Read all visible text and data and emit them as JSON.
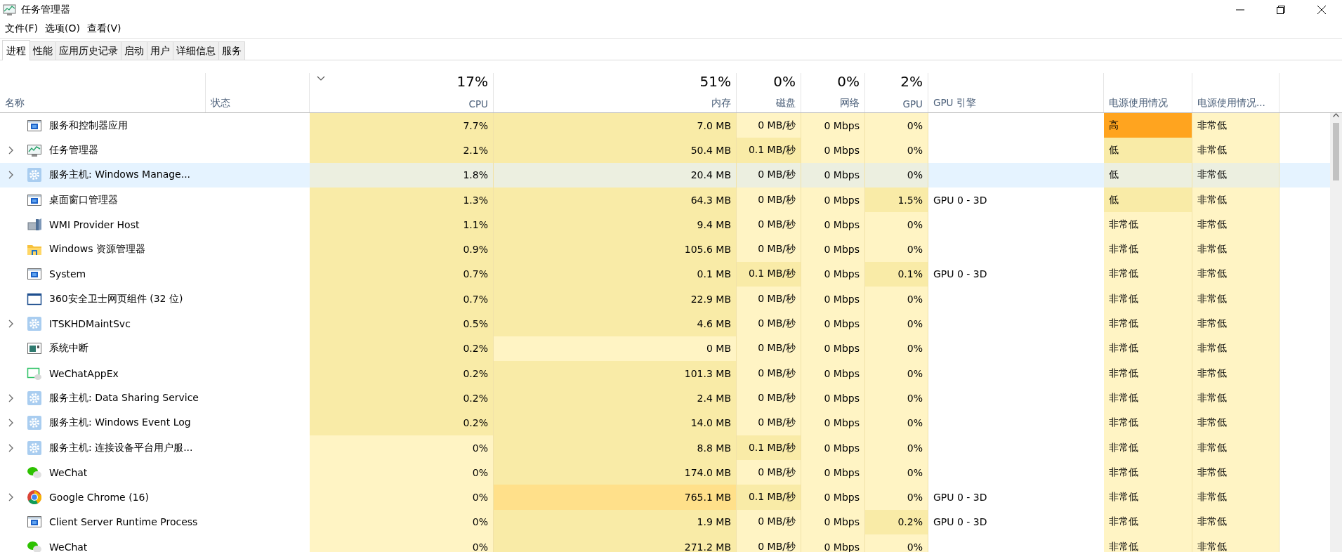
{
  "window": {
    "title": "任务管理器"
  },
  "menu": [
    "文件(F)",
    "选项(O)",
    "查看(V)"
  ],
  "tabs": [
    {
      "label": "进程",
      "selected": true
    },
    {
      "label": "性能",
      "selected": false
    },
    {
      "label": "应用历史记录",
      "selected": false
    },
    {
      "label": "启动",
      "selected": false
    },
    {
      "label": "用户",
      "selected": false
    },
    {
      "label": "详细信息",
      "selected": false
    },
    {
      "label": "服务",
      "selected": false
    }
  ],
  "columns": [
    {
      "label": "名称",
      "sorted": false
    },
    {
      "label": "状态",
      "sorted": false
    },
    {
      "percent": "17%",
      "label": "CPU",
      "sorted": true
    },
    {
      "percent": "51%",
      "label": "内存",
      "sorted": false
    },
    {
      "percent": "0%",
      "label": "磁盘",
      "sorted": false
    },
    {
      "percent": "0%",
      "label": "网络",
      "sorted": false
    },
    {
      "percent": "2%",
      "label": "GPU",
      "sorted": false
    },
    {
      "label": "GPU 引擎",
      "sorted": false
    },
    {
      "label": "电源使用情况",
      "sorted": false
    },
    {
      "label": "电源使用情况...",
      "sorted": false
    }
  ],
  "rows": [
    {
      "name": "服务和控制器应用",
      "kind": "app",
      "expandable": false,
      "selected": false,
      "cells": [
        {
          "text": "7.7%",
          "color": "#f9eba7"
        },
        {
          "text": "7.0 MB",
          "color": "#f9eba7"
        },
        {
          "text": "0 MB/秒",
          "color": "#fff4c4"
        },
        {
          "text": "0 Mbps",
          "color": "#fff4c4"
        },
        {
          "text": "0%",
          "color": "#fff4c4"
        },
        {
          "text": "高",
          "color": "#ffa41f"
        },
        {
          "text": "非常低",
          "color": "#fff4c4"
        }
      ]
    },
    {
      "name": "任务管理器",
      "kind": "taskmgr",
      "expandable": true,
      "selected": false,
      "cells": [
        {
          "text": "2.1%",
          "color": "#f9eba7"
        },
        {
          "text": "50.4 MB",
          "color": "#f9eba7"
        },
        {
          "text": "0.1 MB/秒",
          "color": "#f9eba7"
        },
        {
          "text": "0 Mbps",
          "color": "#fff4c4"
        },
        {
          "text": "0%",
          "color": "#fff4c4"
        },
        {
          "text": "低",
          "color": "#f9eba7"
        },
        {
          "text": "非常低",
          "color": "#fff4c4"
        }
      ]
    },
    {
      "name": "服务主机: Windows Manage...",
      "kind": "service",
      "expandable": true,
      "selected": true,
      "cells": [
        {
          "text": "1.8%",
          "color": "#ecefe0"
        },
        {
          "text": "20.4 MB",
          "color": "#ecefe0"
        },
        {
          "text": "0 MB/秒",
          "color": "#ecefe0"
        },
        {
          "text": "0 Mbps",
          "color": "#ecefe0"
        },
        {
          "text": "0%",
          "color": "#ecefe0"
        },
        {
          "text": "低",
          "color": "#ecefe0"
        },
        {
          "text": "非常低",
          "color": "#ecefe0"
        }
      ]
    },
    {
      "name": "桌面窗口管理器",
      "kind": "app",
      "expandable": false,
      "selected": false,
      "gpu_engine": "GPU 0 - 3D",
      "cells": [
        {
          "text": "1.3%",
          "color": "#f9eba7"
        },
        {
          "text": "64.3 MB",
          "color": "#f9eba7"
        },
        {
          "text": "0 MB/秒",
          "color": "#fff4c4"
        },
        {
          "text": "0 Mbps",
          "color": "#fff4c4"
        },
        {
          "text": "1.5%",
          "color": "#f9eba7"
        },
        {
          "text": "低",
          "color": "#f9eba7"
        },
        {
          "text": "非常低",
          "color": "#fff4c4"
        }
      ]
    },
    {
      "name": "WMI Provider Host",
      "kind": "wmi",
      "expandable": false,
      "selected": false,
      "cells": [
        {
          "text": "1.1%",
          "color": "#f9eba7"
        },
        {
          "text": "9.4 MB",
          "color": "#f9eba7"
        },
        {
          "text": "0 MB/秒",
          "color": "#fff4c4"
        },
        {
          "text": "0 Mbps",
          "color": "#fff4c4"
        },
        {
          "text": "0%",
          "color": "#fff4c4"
        },
        {
          "text": "非常低",
          "color": "#fff4c4"
        },
        {
          "text": "非常低",
          "color": "#fff4c4"
        }
      ]
    },
    {
      "name": "Windows 资源管理器",
      "kind": "explorer",
      "expandable": false,
      "selected": false,
      "cells": [
        {
          "text": "0.9%",
          "color": "#f9eba7"
        },
        {
          "text": "105.6 MB",
          "color": "#f9eba7"
        },
        {
          "text": "0 MB/秒",
          "color": "#fff4c4"
        },
        {
          "text": "0 Mbps",
          "color": "#fff4c4"
        },
        {
          "text": "0%",
          "color": "#fff4c4"
        },
        {
          "text": "非常低",
          "color": "#fff4c4"
        },
        {
          "text": "非常低",
          "color": "#fff4c4"
        }
      ]
    },
    {
      "name": "System",
      "kind": "app",
      "expandable": false,
      "selected": false,
      "gpu_engine": "GPU 0 - 3D",
      "cells": [
        {
          "text": "0.7%",
          "color": "#f9eba7"
        },
        {
          "text": "0.1 MB",
          "color": "#f9eba7"
        },
        {
          "text": "0.1 MB/秒",
          "color": "#f9eba7"
        },
        {
          "text": "0 Mbps",
          "color": "#fff4c4"
        },
        {
          "text": "0.1%",
          "color": "#f9eba7"
        },
        {
          "text": "非常低",
          "color": "#fff4c4"
        },
        {
          "text": "非常低",
          "color": "#fff4c4"
        }
      ]
    },
    {
      "name": "360安全卫士网页组件 (32 位)",
      "kind": "window",
      "expandable": false,
      "selected": false,
      "cells": [
        {
          "text": "0.7%",
          "color": "#f9eba7"
        },
        {
          "text": "22.9 MB",
          "color": "#f9eba7"
        },
        {
          "text": "0 MB/秒",
          "color": "#fff4c4"
        },
        {
          "text": "0 Mbps",
          "color": "#fff4c4"
        },
        {
          "text": "0%",
          "color": "#fff4c4"
        },
        {
          "text": "非常低",
          "color": "#fff4c4"
        },
        {
          "text": "非常低",
          "color": "#fff4c4"
        }
      ]
    },
    {
      "name": "ITSKHDMaintSvc",
      "kind": "service",
      "expandable": true,
      "selected": false,
      "cells": [
        {
          "text": "0.5%",
          "color": "#f9eba7"
        },
        {
          "text": "4.6 MB",
          "color": "#f9eba7"
        },
        {
          "text": "0 MB/秒",
          "color": "#fff4c4"
        },
        {
          "text": "0 Mbps",
          "color": "#fff4c4"
        },
        {
          "text": "0%",
          "color": "#fff4c4"
        },
        {
          "text": "非常低",
          "color": "#fff4c4"
        },
        {
          "text": "非常低",
          "color": "#fff4c4"
        }
      ]
    },
    {
      "name": "系统中断",
      "kind": "interrupt",
      "expandable": false,
      "selected": false,
      "cells": [
        {
          "text": "0.2%",
          "color": "#f9eba7"
        },
        {
          "text": "0 MB",
          "color": "#fff4c4"
        },
        {
          "text": "0 MB/秒",
          "color": "#fff4c4"
        },
        {
          "text": "0 Mbps",
          "color": "#fff4c4"
        },
        {
          "text": "0%",
          "color": "#fff4c4"
        },
        {
          "text": "非常低",
          "color": "#fff4c4"
        },
        {
          "text": "非常低",
          "color": "#fff4c4"
        }
      ]
    },
    {
      "name": "WeChatAppEx",
      "kind": "chatwindow",
      "expandable": false,
      "selected": false,
      "cells": [
        {
          "text": "0.2%",
          "color": "#f9eba7"
        },
        {
          "text": "101.3 MB",
          "color": "#f9eba7"
        },
        {
          "text": "0 MB/秒",
          "color": "#fff4c4"
        },
        {
          "text": "0 Mbps",
          "color": "#fff4c4"
        },
        {
          "text": "0%",
          "color": "#fff4c4"
        },
        {
          "text": "非常低",
          "color": "#fff4c4"
        },
        {
          "text": "非常低",
          "color": "#fff4c4"
        }
      ]
    },
    {
      "name": "服务主机: Data Sharing Service",
      "kind": "service",
      "expandable": true,
      "selected": false,
      "cells": [
        {
          "text": "0.2%",
          "color": "#f9eba7"
        },
        {
          "text": "2.4 MB",
          "color": "#f9eba7"
        },
        {
          "text": "0 MB/秒",
          "color": "#fff4c4"
        },
        {
          "text": "0 Mbps",
          "color": "#fff4c4"
        },
        {
          "text": "0%",
          "color": "#fff4c4"
        },
        {
          "text": "非常低",
          "color": "#fff4c4"
        },
        {
          "text": "非常低",
          "color": "#fff4c4"
        }
      ]
    },
    {
      "name": "服务主机: Windows Event Log",
      "kind": "service",
      "expandable": true,
      "selected": false,
      "cells": [
        {
          "text": "0.2%",
          "color": "#f9eba7"
        },
        {
          "text": "14.0 MB",
          "color": "#f9eba7"
        },
        {
          "text": "0 MB/秒",
          "color": "#fff4c4"
        },
        {
          "text": "0 Mbps",
          "color": "#fff4c4"
        },
        {
          "text": "0%",
          "color": "#fff4c4"
        },
        {
          "text": "非常低",
          "color": "#fff4c4"
        },
        {
          "text": "非常低",
          "color": "#fff4c4"
        }
      ]
    },
    {
      "name": "服务主机: 连接设备平台用户服...",
      "kind": "service",
      "expandable": true,
      "selected": false,
      "cells": [
        {
          "text": "0%",
          "color": "#fff4c4"
        },
        {
          "text": "8.8 MB",
          "color": "#f9eba7"
        },
        {
          "text": "0.1 MB/秒",
          "color": "#f9eba7"
        },
        {
          "text": "0 Mbps",
          "color": "#fff4c4"
        },
        {
          "text": "0%",
          "color": "#fff4c4"
        },
        {
          "text": "非常低",
          "color": "#fff4c4"
        },
        {
          "text": "非常低",
          "color": "#fff4c4"
        }
      ]
    },
    {
      "name": "WeChat",
      "kind": "chat",
      "expandable": false,
      "selected": false,
      "cells": [
        {
          "text": "0%",
          "color": "#fff4c4"
        },
        {
          "text": "174.0 MB",
          "color": "#f9eba7"
        },
        {
          "text": "0 MB/秒",
          "color": "#fff4c4"
        },
        {
          "text": "0 Mbps",
          "color": "#fff4c4"
        },
        {
          "text": "0%",
          "color": "#fff4c4"
        },
        {
          "text": "非常低",
          "color": "#fff4c4"
        },
        {
          "text": "非常低",
          "color": "#fff4c4"
        }
      ]
    },
    {
      "name": "Google Chrome (16)",
      "kind": "browser",
      "expandable": true,
      "selected": false,
      "gpu_engine": "GPU 0 - 3D",
      "cells": [
        {
          "text": "0%",
          "color": "#fff4c4"
        },
        {
          "text": "765.1 MB",
          "color": "#ffe08a"
        },
        {
          "text": "0.1 MB/秒",
          "color": "#f9eba7"
        },
        {
          "text": "0 Mbps",
          "color": "#fff4c4"
        },
        {
          "text": "0%",
          "color": "#fff4c4"
        },
        {
          "text": "非常低",
          "color": "#fff4c4"
        },
        {
          "text": "非常低",
          "color": "#fff4c4"
        }
      ]
    },
    {
      "name": "Client Server Runtime Process",
      "kind": "app",
      "expandable": false,
      "selected": false,
      "gpu_engine": "GPU 0 - 3D",
      "cells": [
        {
          "text": "0%",
          "color": "#fff4c4"
        },
        {
          "text": "1.9 MB",
          "color": "#f9eba7"
        },
        {
          "text": "0 MB/秒",
          "color": "#fff4c4"
        },
        {
          "text": "0 Mbps",
          "color": "#fff4c4"
        },
        {
          "text": "0.2%",
          "color": "#f9eba7"
        },
        {
          "text": "非常低",
          "color": "#fff4c4"
        },
        {
          "text": "非常低",
          "color": "#fff4c4"
        }
      ]
    },
    {
      "name": "WeChat",
      "kind": "chat",
      "expandable": false,
      "selected": false,
      "cells": [
        {
          "text": "0%",
          "color": "#fff4c4"
        },
        {
          "text": "271.2 MB",
          "color": "#f9eba7"
        },
        {
          "text": "0 MB/秒",
          "color": "#fff4c4"
        },
        {
          "text": "0 Mbps",
          "color": "#fff4c4"
        },
        {
          "text": "0%",
          "color": "#fff4c4"
        },
        {
          "text": "非常低",
          "color": "#fff4c4"
        },
        {
          "text": "非常低",
          "color": "#fff4c4"
        }
      ]
    }
  ]
}
